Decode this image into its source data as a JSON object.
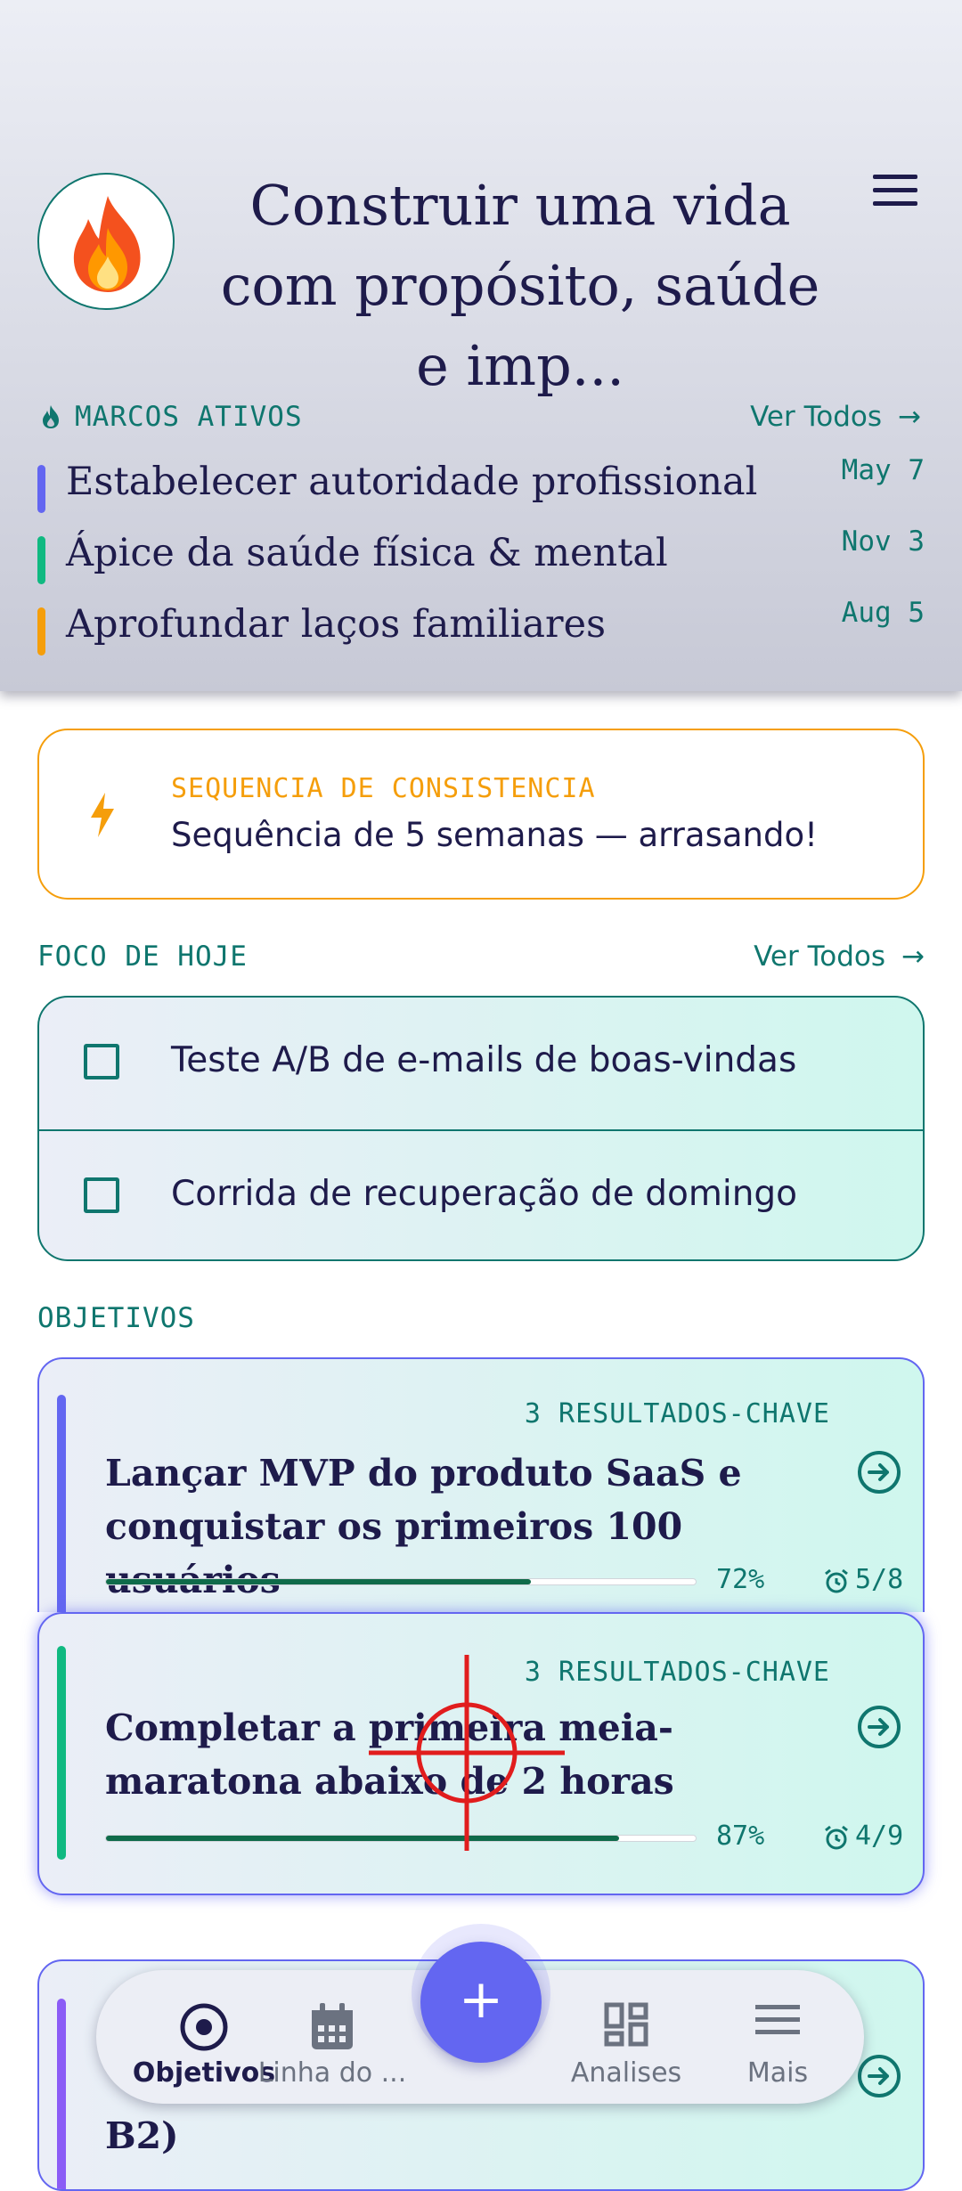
{
  "header": {
    "goal_title": "Construir uma vida com propósito, saúde e imp...",
    "avatar_icon": "fire-emoji-icon",
    "menu_icon": "hamburger-menu-icon"
  },
  "milestones": {
    "label": "MARCOS ATIVOS",
    "see_all": "Ver Todos",
    "items": [
      {
        "name": "Estabelecer autoridade profissional",
        "date": "May 7",
        "color": "#6366f1"
      },
      {
        "name": "Ápice da saúde física & mental",
        "date": "Nov 3",
        "color": "#10b981"
      },
      {
        "name": "Aprofundar laços familiares",
        "date": "Aug 5",
        "color": "#f59e0b"
      }
    ]
  },
  "streak": {
    "label": "SEQUENCIA DE CONSISTENCIA",
    "text": "Sequência de 5 semanas — arrasando!",
    "color": "#f59e0b"
  },
  "focus": {
    "label": "FOCO DE HOJE",
    "see_all": "Ver Todos",
    "tasks": [
      {
        "title": "Teste A/B de e-mails de boas-vindas",
        "checked": false
      },
      {
        "title": "Corrida de recuperação de domingo",
        "checked": false
      }
    ]
  },
  "objectives": {
    "label": "OBJETIVOS",
    "items": [
      {
        "key_results": "3 RESULTADOS-CHAVE",
        "title": "Lançar MVP do produto SaaS e conquistar os primeiros 100 usuários",
        "progress": 0.72,
        "percent": "72%",
        "tasks": "5/8",
        "color": "#6366f1"
      },
      {
        "key_results": "3 RESULTADOS-CHAVE",
        "title": "Completar a primeira meia-maratona abaixo de 2 horas",
        "progress": 0.87,
        "percent": "87%",
        "tasks": "4/9",
        "color": "#10b981"
      },
      {
        "key_results": "",
        "title": "B2)",
        "color": "#8b5cf6"
      }
    ]
  },
  "nav": {
    "items": [
      {
        "label": "Objetivos",
        "icon": "target-icon",
        "active": true
      },
      {
        "label": "Linha do ...",
        "icon": "calendar-icon",
        "active": false
      },
      {
        "label": "Analises",
        "icon": "dashboard-icon",
        "active": false
      },
      {
        "label": "Mais",
        "icon": "menu-icon",
        "active": false
      }
    ],
    "fab_label": "+"
  },
  "colors": {
    "accent": "#6366f1",
    "teal": "#0f766e",
    "ink": "#1e1b4b"
  }
}
